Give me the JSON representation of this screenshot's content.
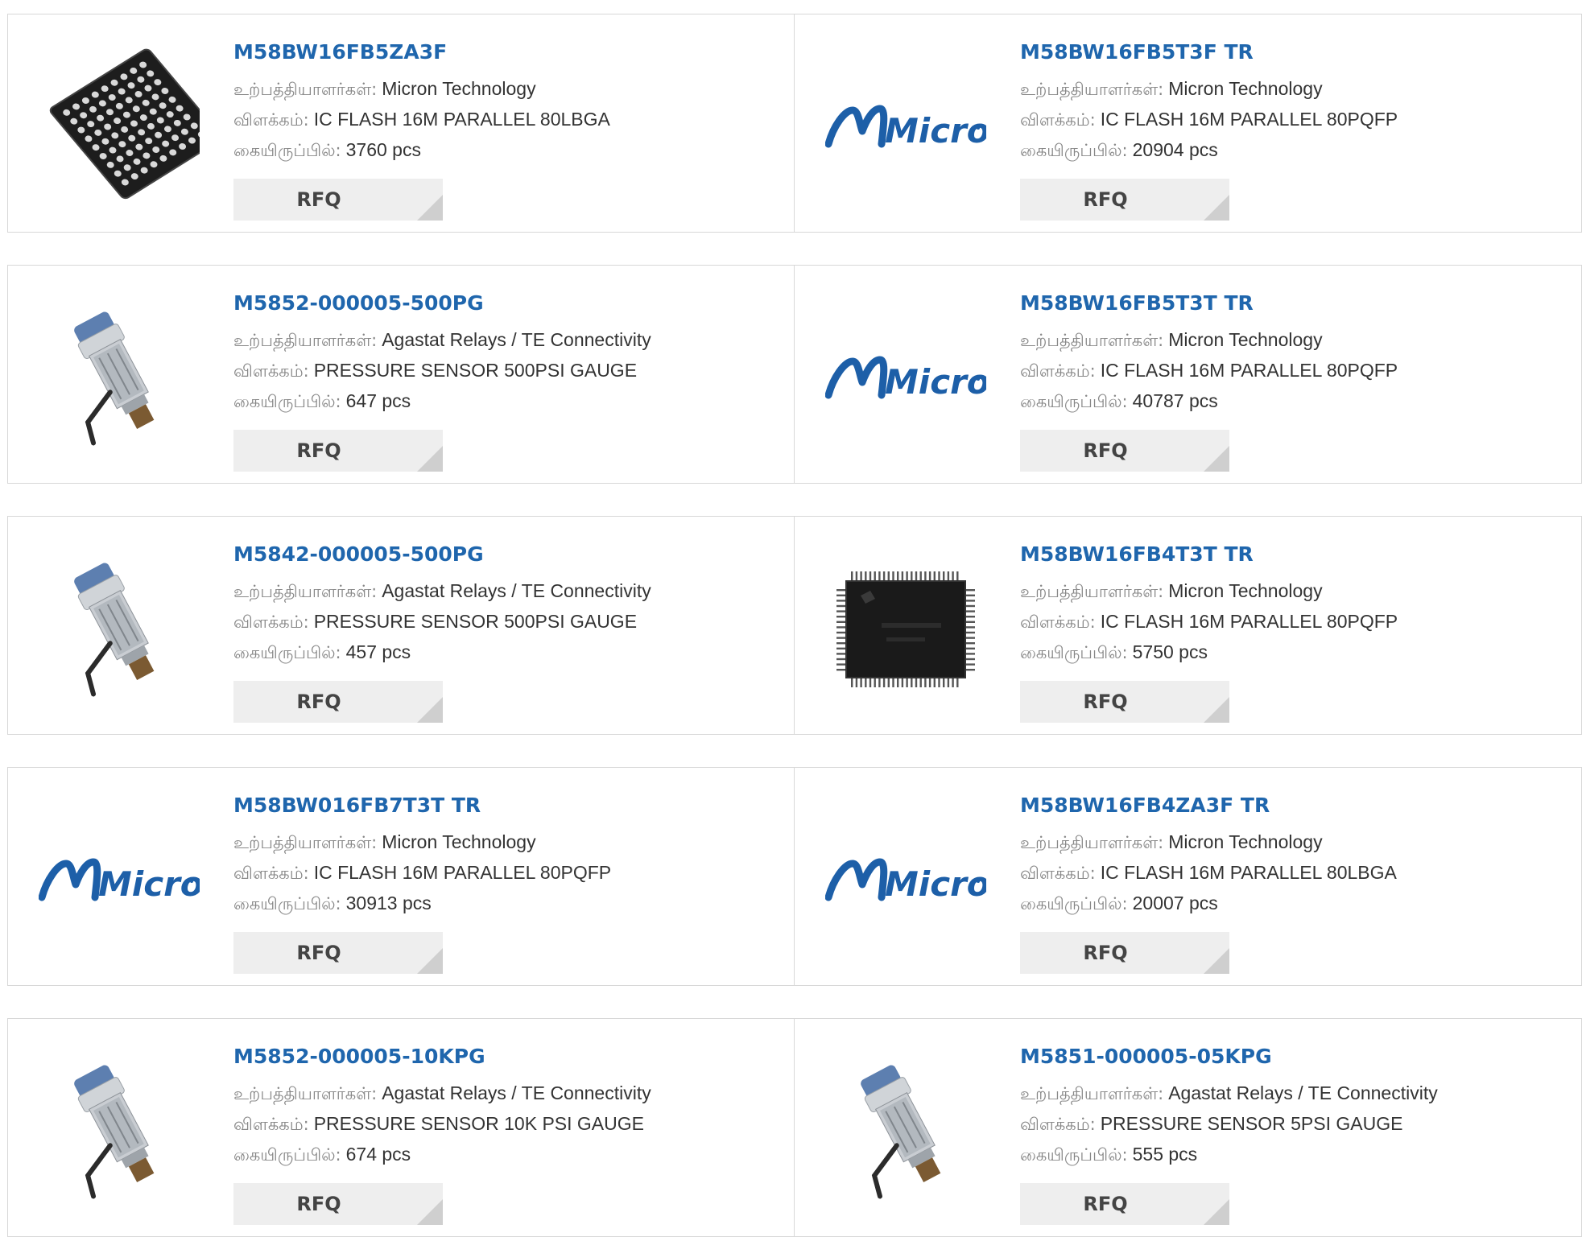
{
  "labels": {
    "manufacturer": "உற்பத்தியாளர்கள்:",
    "description": "விளக்கம்:",
    "stock": "கையிருப்பில்:",
    "rfq": "RFQ"
  },
  "brand_logo_text": "Micron",
  "products": [
    {
      "part": "M58BW16FB5ZA3F",
      "manufacturer": "Micron Technology",
      "description": "IC FLASH 16M PARALLEL 80LBGA",
      "stock": "3760 pcs",
      "image": "bga-chip-icon"
    },
    {
      "part": "M58BW16FB5T3F TR",
      "manufacturer": "Micron Technology",
      "description": "IC FLASH 16M PARALLEL 80PQFP",
      "stock": "20904 pcs",
      "image": "micron-logo"
    },
    {
      "part": "M5852-000005-500PG",
      "manufacturer": "Agastat Relays / TE Connectivity",
      "description": "PRESSURE SENSOR 500PSI GAUGE",
      "stock": "647 pcs",
      "image": "pressure-sensor-icon"
    },
    {
      "part": "M58BW16FB5T3T TR",
      "manufacturer": "Micron Technology",
      "description": "IC FLASH 16M PARALLEL 80PQFP",
      "stock": "40787 pcs",
      "image": "micron-logo"
    },
    {
      "part": "M5842-000005-500PG",
      "manufacturer": "Agastat Relays / TE Connectivity",
      "description": "PRESSURE SENSOR 500PSI GAUGE",
      "stock": "457 pcs",
      "image": "pressure-sensor-icon"
    },
    {
      "part": "M58BW16FB4T3T TR",
      "manufacturer": "Micron Technology",
      "description": "IC FLASH 16M PARALLEL 80PQFP",
      "stock": "5750 pcs",
      "image": "qfp-chip-icon"
    },
    {
      "part": "M58BW016FB7T3T TR",
      "manufacturer": "Micron Technology",
      "description": "IC FLASH 16M PARALLEL 80PQFP",
      "stock": "30913 pcs",
      "image": "micron-logo"
    },
    {
      "part": "M58BW16FB4ZA3F TR",
      "manufacturer": "Micron Technology",
      "description": "IC FLASH 16M PARALLEL 80LBGA",
      "stock": "20007 pcs",
      "image": "micron-logo"
    },
    {
      "part": "M5852-000005-10KPG",
      "manufacturer": "Agastat Relays / TE Connectivity",
      "description": "PRESSURE SENSOR 10K PSI GAUGE",
      "stock": "674 pcs",
      "image": "pressure-sensor-icon"
    },
    {
      "part": "M5851-000005-05KPG",
      "manufacturer": "Agastat Relays / TE Connectivity",
      "description": "PRESSURE SENSOR 5PSI GAUGE",
      "stock": "555 pcs",
      "image": "pressure-sensor-icon"
    }
  ],
  "colors": {
    "link": "#1f66ad",
    "micron_blue": "#1d5fa8",
    "rfq_bg": "#eeeeee",
    "border": "#d8d8d8"
  }
}
